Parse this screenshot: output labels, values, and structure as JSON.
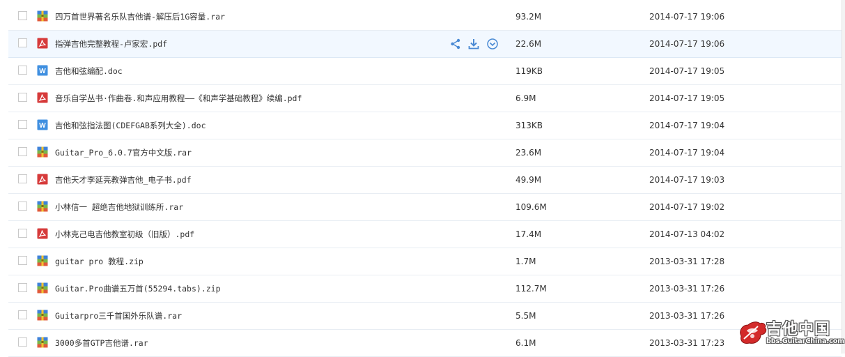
{
  "files": [
    {
      "name": "四万首世界著名乐队吉他谱-解压后1G容量.rar",
      "type": "archive",
      "icon": "archive-icon",
      "size": "93.2M",
      "date": "2014-07-17 19:06"
    },
    {
      "name": "指弹吉他完整教程-卢家宏.pdf",
      "type": "pdf",
      "icon": "pdf-icon",
      "size": "22.6M",
      "date": "2014-07-17 19:06",
      "hovered": true
    },
    {
      "name": "吉他和弦编配.doc",
      "type": "doc",
      "icon": "word-icon",
      "size": "119KB",
      "date": "2014-07-17 19:05"
    },
    {
      "name": "音乐自学丛书·作曲卷.和声应用教程——《和声学基础教程》续编.pdf",
      "type": "pdf",
      "icon": "pdf-icon",
      "size": "6.9M",
      "date": "2014-07-17 19:05"
    },
    {
      "name": "吉他和弦指法图(CDEFGAB系列大全).doc",
      "type": "doc",
      "icon": "word-icon",
      "size": "313KB",
      "date": "2014-07-17 19:04"
    },
    {
      "name": "Guitar_Pro_6.0.7官方中文版.rar",
      "type": "archive",
      "icon": "archive-icon",
      "size": "23.6M",
      "date": "2014-07-17 19:04"
    },
    {
      "name": "吉他天才李延亮教弹吉他_电子书.pdf",
      "type": "pdf",
      "icon": "pdf-icon",
      "size": "49.9M",
      "date": "2014-07-17 19:03"
    },
    {
      "name": "小林信一 超绝吉他地狱训练所.rar",
      "type": "archive",
      "icon": "archive-icon",
      "size": "109.6M",
      "date": "2014-07-17 19:02"
    },
    {
      "name": "小林克己电吉他教室初级（旧版）.pdf",
      "type": "pdf",
      "icon": "pdf-icon",
      "size": "17.4M",
      "date": "2014-07-13 04:02"
    },
    {
      "name": "guitar pro 教程.zip",
      "type": "archive",
      "icon": "archive-icon",
      "size": "1.7M",
      "date": "2013-03-31 17:28"
    },
    {
      "name": "Guitar.Pro曲谱五万首(55294.tabs).zip",
      "type": "archive",
      "icon": "archive-icon",
      "size": "112.7M",
      "date": "2013-03-31 17:26"
    },
    {
      "name": "Guitarpro三千首国外乐队谱.rar",
      "type": "archive",
      "icon": "archive-icon",
      "size": "5.5M",
      "date": "2013-03-31 17:26"
    },
    {
      "name": "3000多首GTP吉他谱.rar",
      "type": "archive",
      "icon": "archive-icon",
      "size": "6.1M",
      "date": "2013-03-31 17:23"
    }
  ],
  "row_actions": [
    {
      "icon": "share-icon"
    },
    {
      "icon": "download-icon"
    },
    {
      "icon": "more-dropdown-icon"
    }
  ],
  "watermark": {
    "title": "吉他中国",
    "url": "bbs.GuitarChina.com"
  },
  "colors": {
    "accent": "#4a8ad4",
    "hover_row": "#f2f8ff",
    "pdf_red": "#d63a3a",
    "word_blue": "#3f8fe0"
  }
}
